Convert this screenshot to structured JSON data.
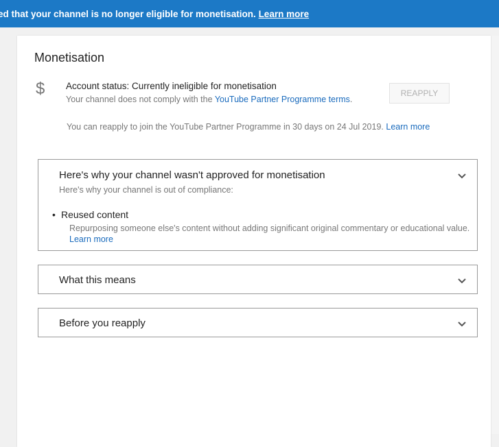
{
  "banner": {
    "message": "ed that your channel is no longer eligible for monetisation.",
    "link": "Learn more"
  },
  "monetisation": {
    "title": "Monetisation",
    "icon": "dollar-icon",
    "icon_glyph": "$",
    "account_status": "Account status: Currently ineligible for monetisation",
    "sub_prefix": "Your channel does not comply with the",
    "sub_link": "YouTube Partner Programme terms",
    "sub_suffix": ".",
    "reapply_button": "REAPPLY",
    "notice_text": "You can reapply to join the YouTube Partner Programme in 30 days on 24 Jul 2019.",
    "notice_link": "Learn more"
  },
  "panels": [
    {
      "title": "Here's why your channel wasn't approved for monetisation",
      "subtitle": "Here's why your channel is out of compliance:",
      "bullet_title": "Reused content",
      "bullet_desc": "Repurposing someone else's content without adding significant original commentary or educational value.",
      "bullet_link": "Learn more"
    },
    {
      "title": "What this means"
    },
    {
      "title": "Before you reapply"
    }
  ],
  "colors": {
    "banner_bg": "#1c79c6",
    "link_blue": "#1a6bbd"
  }
}
